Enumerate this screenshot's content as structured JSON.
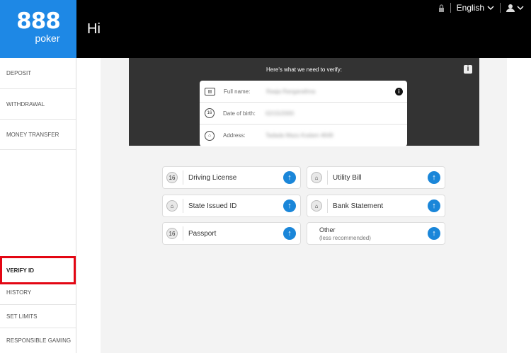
{
  "brand": {
    "number": "888",
    "product": "poker"
  },
  "header": {
    "greeting": "Hi"
  },
  "topbar": {
    "language": "English"
  },
  "sidebar": {
    "items": [
      {
        "label": "DEPOSIT"
      },
      {
        "label": "WITHDRAWAL"
      },
      {
        "label": "MONEY TRANSFER"
      },
      {
        "label": "VERIFY ID"
      },
      {
        "label": "HISTORY"
      },
      {
        "label": "SET LIMITS"
      },
      {
        "label": "RESPONSIBLE GAMING"
      }
    ]
  },
  "verify": {
    "heading": "Here's what we need to verify:",
    "fields": [
      {
        "label": "Full name:",
        "value": "Raaja Rangarathna"
      },
      {
        "label": "Date of birth:",
        "value": "02/15/2000"
      },
      {
        "label": "Address:",
        "value": "Tadada Mazu Kodam 4649"
      }
    ]
  },
  "documents": [
    {
      "label": "Driving License"
    },
    {
      "label": "Utility Bill"
    },
    {
      "label": "State Issued ID"
    },
    {
      "label": "Bank Statement"
    },
    {
      "label": "Passport"
    },
    {
      "label": "Other",
      "sub": "(less recommended)"
    }
  ],
  "colors": {
    "brand_blue": "#1e88e5",
    "upload_blue": "#1a86d9",
    "highlight_red": "#e30613"
  }
}
